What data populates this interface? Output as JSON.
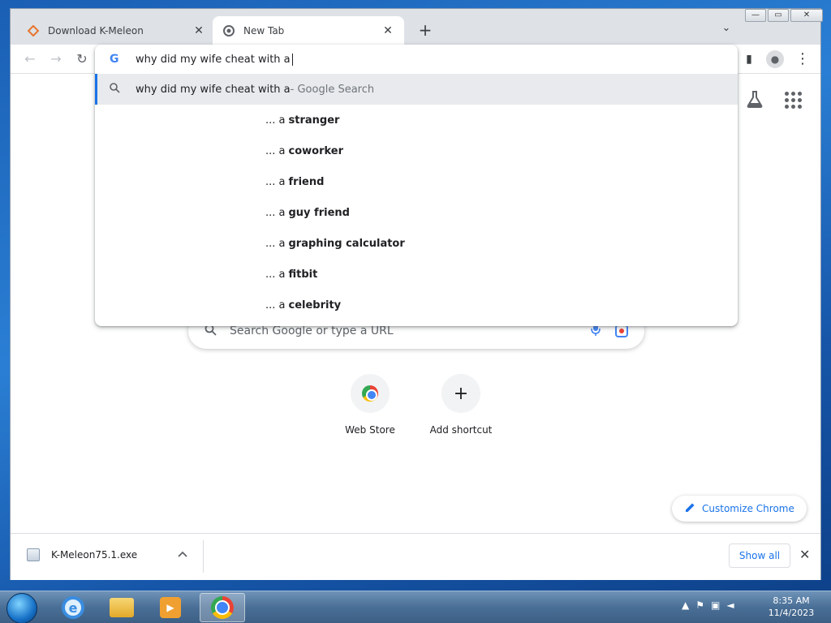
{
  "window": {
    "tabs": [
      {
        "title": "Download K-Meleon",
        "favicon": "kmeleon-icon"
      },
      {
        "title": "New Tab",
        "favicon": "chrome-icon"
      }
    ],
    "new_tab_glyph": "+",
    "tab_search_glyph": "⌄",
    "controls": {
      "minimize": "—",
      "restore": "▭",
      "close": "✕"
    }
  },
  "toolbar": {
    "back": "←",
    "forward": "→",
    "reload": "↻",
    "sidepanel": "▮",
    "menu": "⋮"
  },
  "omnibox": {
    "input_text": "why did my wife cheat with a ",
    "google_glyph": "G",
    "first": {
      "query": "why did my wife cheat with a",
      "suffix": " - Google Search"
    },
    "suggestions": [
      {
        "prefix": "... a",
        "bold": "stranger"
      },
      {
        "prefix": "... a",
        "bold": "coworker"
      },
      {
        "prefix": "... a",
        "bold": "friend"
      },
      {
        "prefix": "... a",
        "bold": "guy friend"
      },
      {
        "prefix": "... a",
        "bold": "graphing calculator"
      },
      {
        "prefix": "... a",
        "bold": "fitbit"
      },
      {
        "prefix": "... a",
        "bold": "celebrity"
      }
    ]
  },
  "ntp": {
    "search_placeholder": "Search Google or type a URL",
    "shortcuts": [
      {
        "label": "Web Store",
        "icon": "webstore-icon"
      },
      {
        "label": "Add shortcut",
        "icon": "plus-icon",
        "glyph": "+"
      }
    ],
    "customize_label": "Customize Chrome"
  },
  "download_shelf": {
    "filename": "K-Meleon75.1.exe",
    "show_all": "Show all",
    "close": "✕"
  },
  "taskbar": {
    "time": "8:35 AM",
    "date": "11/4/2023"
  },
  "colors": {
    "accent": "#1a73e8",
    "tabstrip": "#dee1e6",
    "highlight": "#e8eaed"
  }
}
